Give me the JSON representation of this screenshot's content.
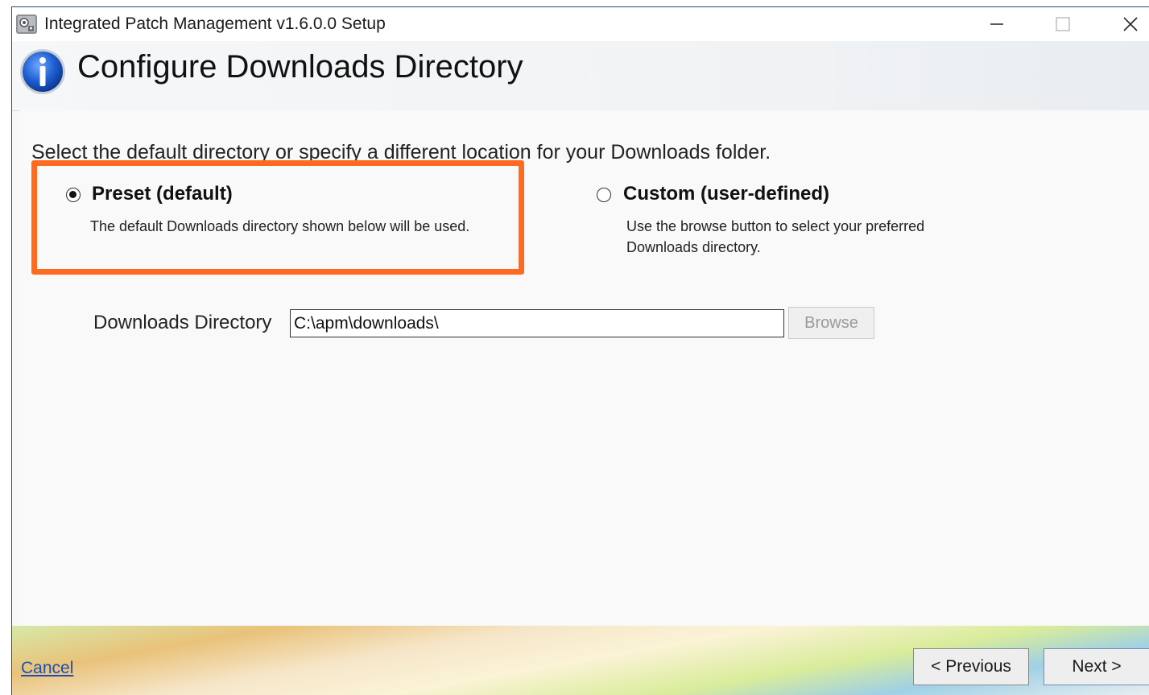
{
  "window": {
    "title": "Integrated Patch Management v1.6.0.0 Setup",
    "controls": {
      "minimize": "minimize-icon",
      "maximize": "maximize-icon",
      "close": "close-icon"
    }
  },
  "header": {
    "title": "Configure Downloads Directory",
    "icon": "info-icon"
  },
  "main": {
    "instruction": "Select the default directory or specify a different location for your Downloads folder.",
    "options": [
      {
        "label": "Preset (default)",
        "description": "The default Downloads directory shown below will be used.",
        "selected": true,
        "highlighted": true
      },
      {
        "label": "Custom (user-defined)",
        "description_lines": [
          "Use the browse button to select your preferred",
          "Downloads directory."
        ],
        "selected": false
      }
    ],
    "directory": {
      "label": "Downloads Directory",
      "value": "C:\\apm\\downloads\\",
      "browse_label": "Browse",
      "browse_enabled": false
    }
  },
  "footer": {
    "cancel_label": "Cancel",
    "previous_label": "< Previous",
    "next_label": "Next >"
  },
  "colors": {
    "highlight": "#ff6a21",
    "link": "#1a4fb5",
    "window_border": "#2b4a78"
  }
}
